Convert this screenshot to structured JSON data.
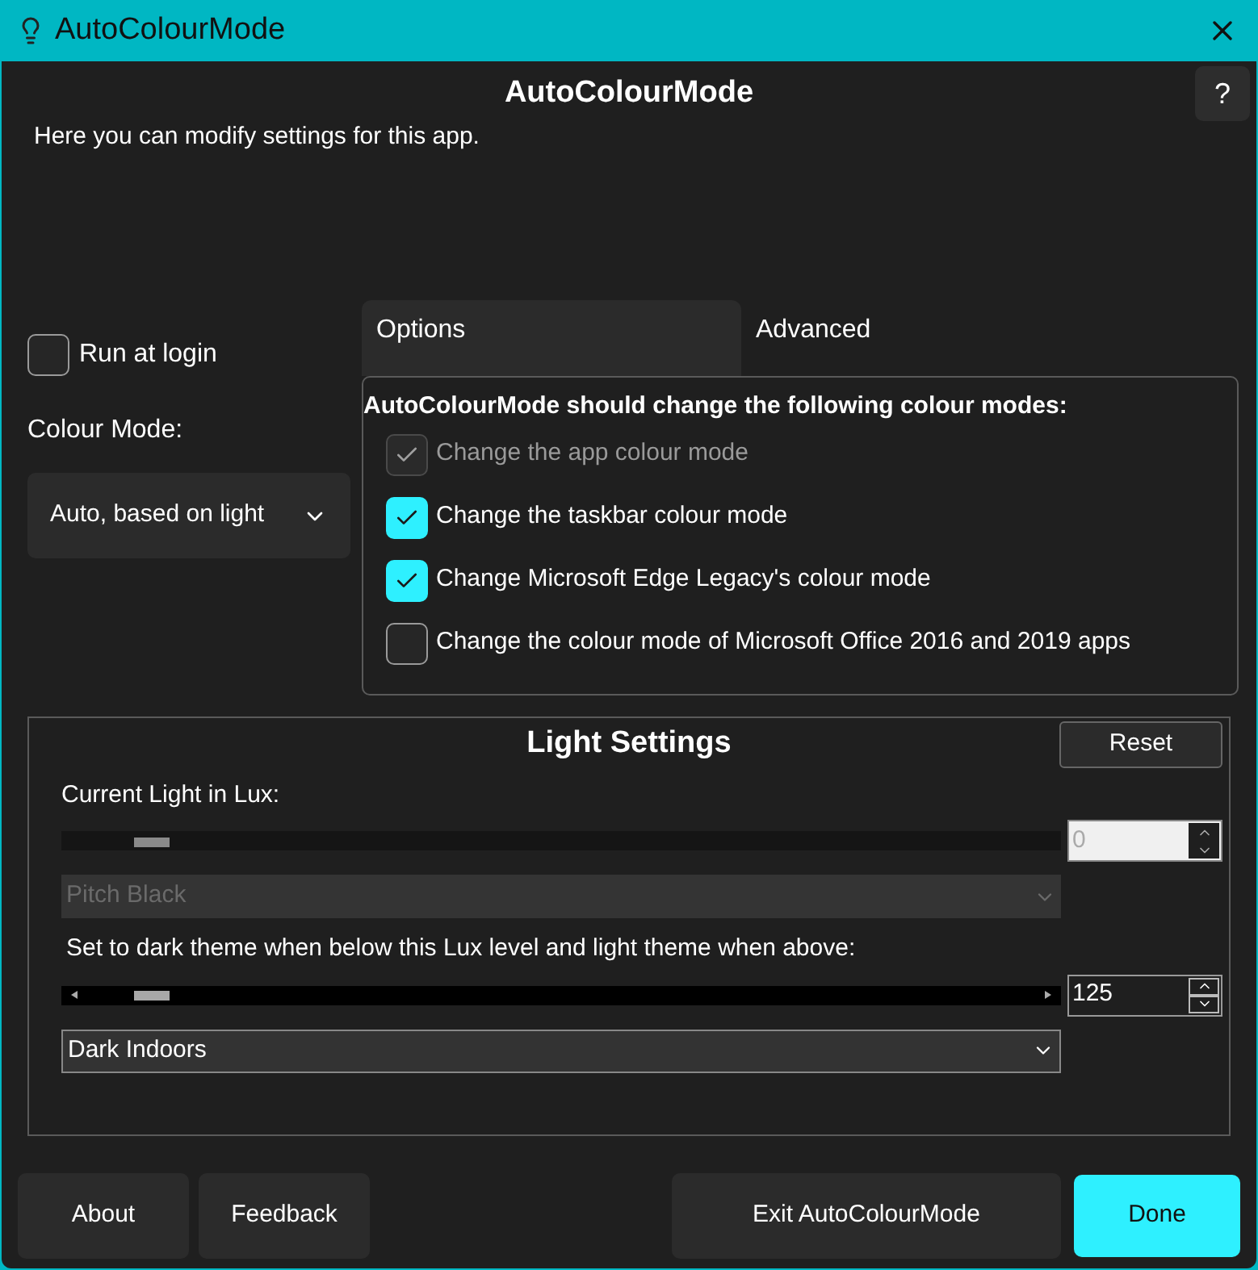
{
  "window": {
    "title": "AutoColourMode"
  },
  "header": {
    "title": "AutoColourMode",
    "help": "?",
    "description": "Here you can modify settings for this app."
  },
  "run_at_login": {
    "label": "Run at login",
    "checked": false
  },
  "colour_mode": {
    "label": "Colour Mode:",
    "value": "Auto, based on light"
  },
  "tabs": [
    {
      "label": "Options",
      "selected": true
    },
    {
      "label": "Advanced",
      "selected": false
    }
  ],
  "options": {
    "heading": "AutoColourMode should change the following colour modes:",
    "items": [
      {
        "label": "Change the app colour mode",
        "checked": true,
        "disabled": true
      },
      {
        "label": "Change the taskbar colour mode",
        "checked": true,
        "disabled": false
      },
      {
        "label": "Change Microsoft Edge Legacy's colour mode",
        "checked": true,
        "disabled": false
      },
      {
        "label": "Change the colour mode of Microsoft Office 2016 and 2019 apps",
        "checked": false,
        "disabled": false
      }
    ]
  },
  "light_settings": {
    "title": "Light Settings",
    "reset": "Reset",
    "rows": [
      {
        "label": "Current Light in Lux:",
        "level": 0.05,
        "value": "0",
        "disabled": true,
        "preset": "Pitch Black"
      },
      {
        "label": "Set to dark theme when below this Lux level and light theme when above:",
        "level": 0.05,
        "value": "125",
        "disabled": false,
        "preset": "Dark Indoors"
      }
    ]
  },
  "footer": {
    "left": [
      "About",
      "Feedback"
    ],
    "exit": "Exit AutoColourMode",
    "done": "Done"
  }
}
